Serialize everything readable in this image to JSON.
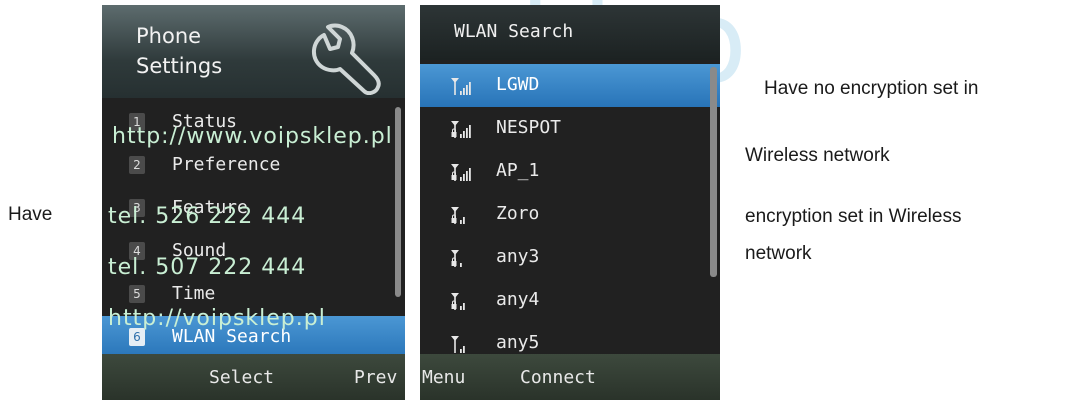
{
  "watermark": {
    "big": "klep",
    "lines": [
      "http://www.voipsklep.pl",
      "tel. 526 222 444",
      "tel. 507 222 444",
      "http://voipsklep.pl"
    ]
  },
  "annotations": {
    "left": "Have",
    "right_line1": "Have no encryption set in",
    "right_line2": "Wireless network",
    "right_line3": "encryption set in Wireless",
    "right_line4": "network"
  },
  "phone_settings": {
    "title_line1": "Phone",
    "title_line2": "Settings",
    "header_icon": "wrench-icon",
    "items": [
      {
        "num": "1",
        "label": "Status"
      },
      {
        "num": "2",
        "label": "Preference"
      },
      {
        "num": "3",
        "label": "Feature"
      },
      {
        "num": "4",
        "label": "Sound"
      },
      {
        "num": "5",
        "label": "Time"
      },
      {
        "num": "6",
        "label": "WLAN Search",
        "selected": true
      }
    ],
    "softkeys": {
      "center": "Select",
      "right": "Prev"
    }
  },
  "wlan_search": {
    "title": "WLAN Search",
    "access_points": [
      {
        "ssid": "LGWD",
        "signal": 4,
        "encrypted": false,
        "selected": true
      },
      {
        "ssid": "NESPOT",
        "signal": 4,
        "encrypted": true
      },
      {
        "ssid": "AP_1",
        "signal": 4,
        "encrypted": true
      },
      {
        "ssid": "Zoro",
        "signal": 2,
        "encrypted": true
      },
      {
        "ssid": "any3",
        "signal": 1,
        "encrypted": true
      },
      {
        "ssid": "any4",
        "signal": 2,
        "encrypted": true
      },
      {
        "ssid": "any5",
        "signal": 2,
        "encrypted": false
      }
    ],
    "softkeys": {
      "left": "Menu",
      "center": "Connect"
    }
  },
  "colors": {
    "selection": "#2e7dc1",
    "background": "#212121",
    "watermark_green": "#c9efd4",
    "watermark_blue": "#d8ecf6"
  }
}
